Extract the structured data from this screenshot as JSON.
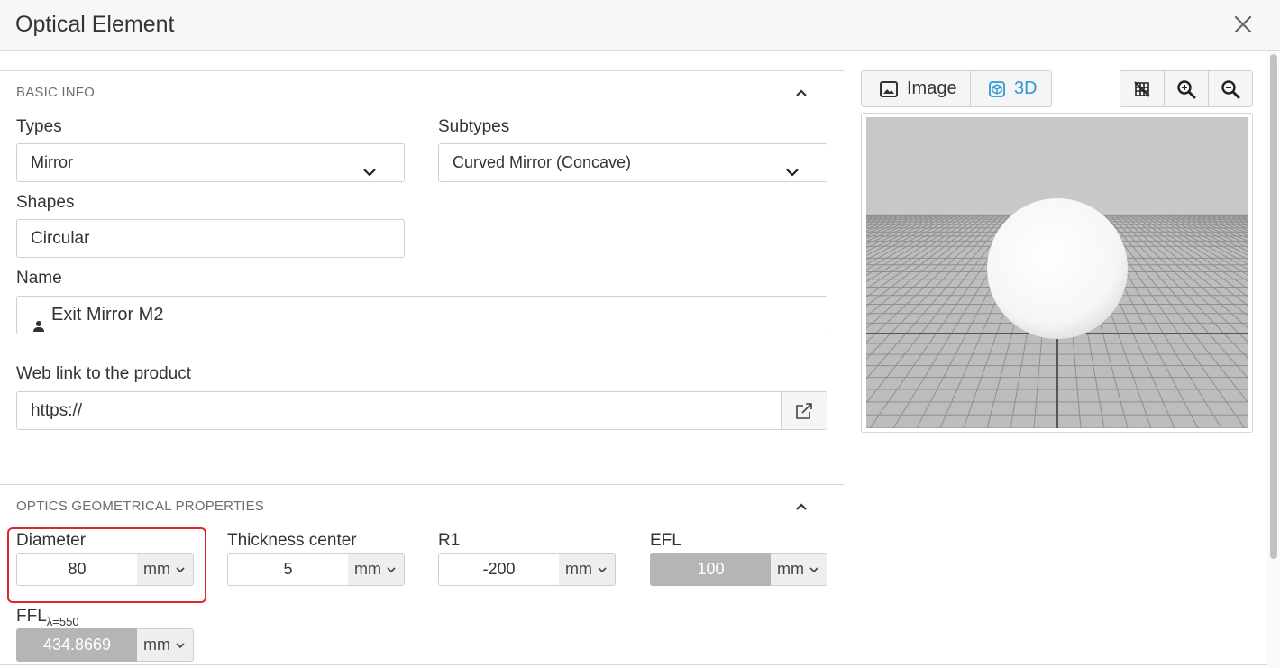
{
  "dialog": {
    "title": "Optical Element",
    "close_icon": "close-icon"
  },
  "basic_info": {
    "title": "BASIC INFO",
    "types_label": "Types",
    "types_value": "Mirror",
    "subtypes_label": "Subtypes",
    "subtypes_value": "Curved Mirror (Concave)",
    "shapes_label": "Shapes",
    "shapes_value": "Circular",
    "name_label": "Name",
    "name_value": "Exit Mirror M2",
    "weblink_label": "Web link to the product",
    "weblink_value": "https://"
  },
  "optics": {
    "title": "OPTICS GEOMETRICAL PROPERTIES",
    "diameter": {
      "label": "Diameter",
      "value": "80",
      "unit": "mm"
    },
    "thickness": {
      "label": "Thickness center",
      "value": "5",
      "unit": "mm"
    },
    "r1": {
      "label": "R1",
      "value": "-200",
      "unit": "mm"
    },
    "efl": {
      "label": "EFL",
      "value": "100",
      "unit": "mm"
    },
    "ffl": {
      "label": "FFL",
      "sub": "λ=550",
      "value": "434.8669",
      "unit": "mm"
    }
  },
  "viewer": {
    "image_tab": "Image",
    "tab_3d": "3D",
    "active_tab": "3D",
    "accent_color": "#2b9ad6"
  }
}
